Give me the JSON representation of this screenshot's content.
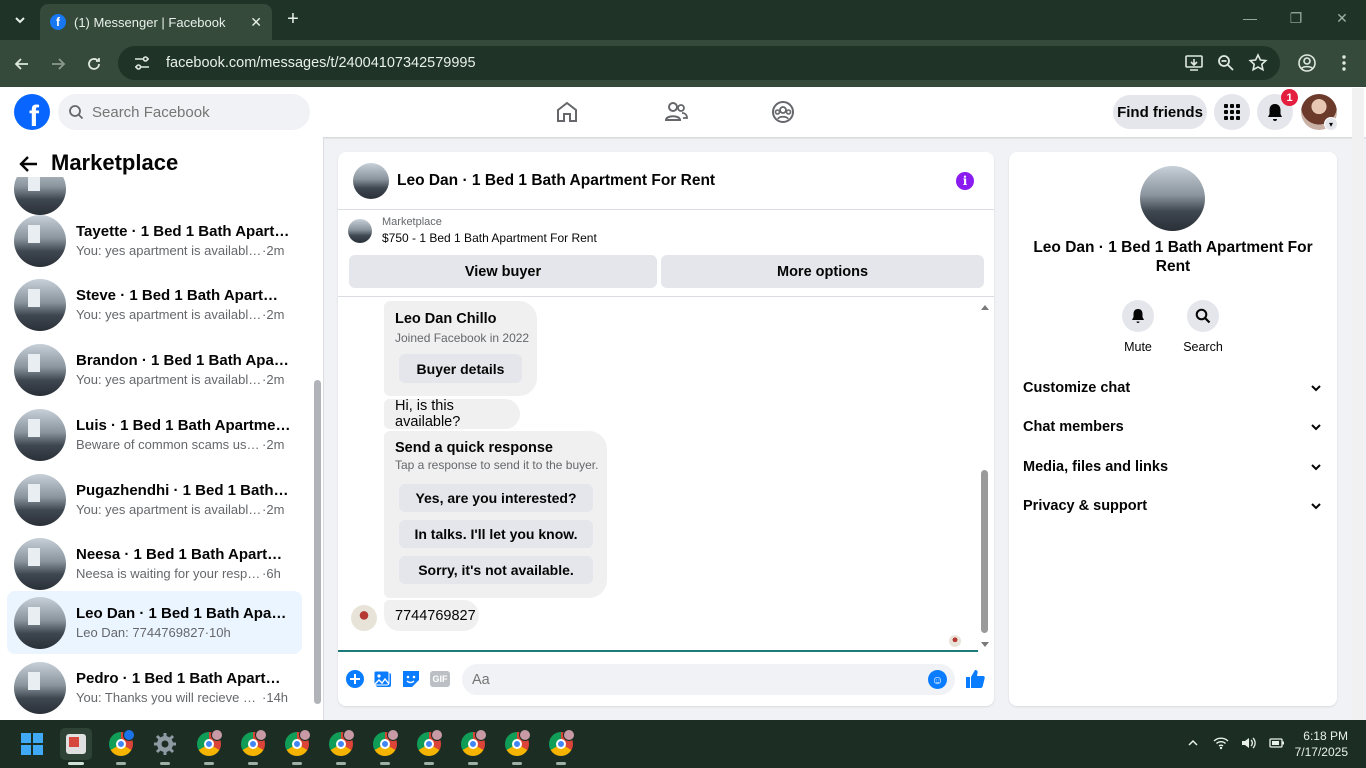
{
  "browser": {
    "tab_title": "(1) Messenger | Facebook",
    "url": "facebook.com/messages/t/24004107342579995"
  },
  "fb_header": {
    "search_placeholder": "Search Facebook",
    "find_friends": "Find friends",
    "notification_count": "1",
    "nav_icons": [
      "home-icon",
      "friends-icon",
      "groups-icon"
    ]
  },
  "left_panel": {
    "title": "Marketplace",
    "conversations": [
      {
        "name": "Tayette · 1 Bed 1 Bath Apartmen...",
        "snippet": "You: yes apartment is available sha...",
        "time": "2m",
        "active": false
      },
      {
        "name": "Steve · 1 Bed 1 Bath Apartment ...",
        "snippet": "You: yes apartment is available sha...",
        "time": "2m",
        "active": false
      },
      {
        "name": "Brandon · 1 Bed 1 Bath Apartme...",
        "snippet": "You: yes apartment is available sha...",
        "time": "2m",
        "active": false
      },
      {
        "name": "Luis · 1 Bed 1 Bath Apartment Fo...",
        "snippet": "Beware of common scams using p...",
        "time": "2m",
        "active": false
      },
      {
        "name": "Pugazhendhi · 1 Bed 1 Bath Apar...",
        "snippet": "You: yes apartment is available sha...",
        "time": "2m",
        "active": false
      },
      {
        "name": "Neesa · 1 Bed 1 Bath Apartment ...",
        "snippet": "Neesa is waiting for your response.",
        "time": "6h",
        "active": false
      },
      {
        "name": "Leo Dan · 1 Bed 1 Bath Apartme...",
        "snippet": "Leo Dan: 7744769827",
        "time": "10h",
        "active": true
      },
      {
        "name": "Pedro · 1 Bed 1 Bath Apartment ...",
        "snippet": "You: Thanks you will recieve a text...",
        "time": "14h",
        "active": false
      }
    ]
  },
  "chat": {
    "title": "Leo Dan · 1 Bed 1 Bath Apartment For Rent",
    "marketplace_label": "Marketplace",
    "listing": "$750 - 1 Bed 1 Bath Apartment For Rent",
    "view_buyer": "View buyer",
    "more_options": "More options",
    "buyer_name": "Leo Dan Chillo",
    "buyer_joined": "Joined Facebook in 2022",
    "buyer_details": "Buyer details",
    "msg_available": "Hi, is this available?",
    "quick_title": "Send a quick response",
    "quick_sub": "Tap a response to send it to the buyer.",
    "quick_replies": [
      "Yes, are you interested?",
      "In talks. I'll let you know.",
      "Sorry, it's not available."
    ],
    "msg_phone": "7744769827",
    "composer_placeholder": "Aa"
  },
  "right_panel": {
    "name": "Leo Dan · 1 Bed 1 Bath Apartment For Rent",
    "mute": "Mute",
    "search": "Search",
    "sections": [
      "Customize chat",
      "Chat members",
      "Media, files and links",
      "Privacy & support"
    ]
  },
  "taskbar": {
    "time": "6:18 PM",
    "date": "7/17/2025"
  }
}
